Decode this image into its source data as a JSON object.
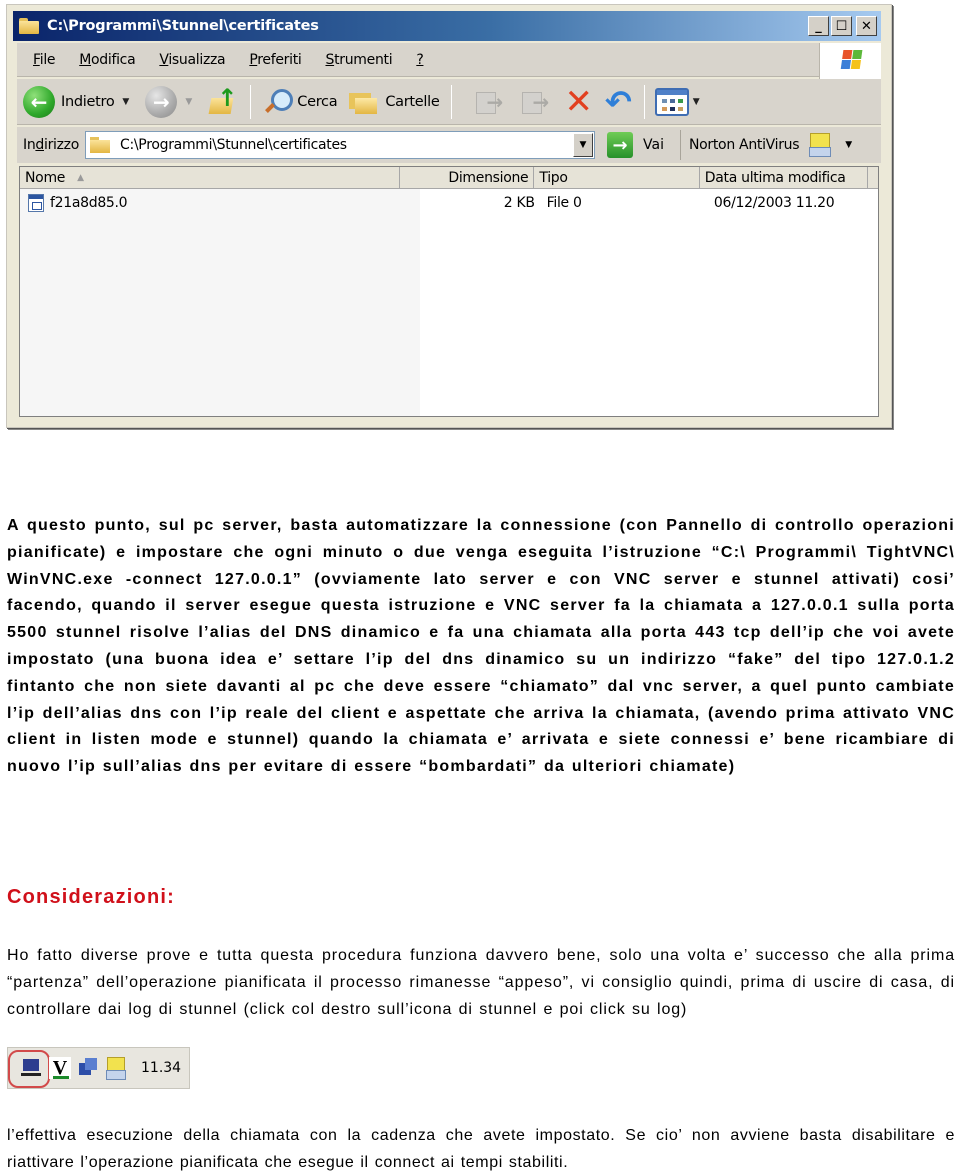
{
  "explorer": {
    "title": "C:\\Programmi\\Stunnel\\certificates",
    "window_buttons": {
      "minimize": "_",
      "maximize": "☐",
      "close": "✕"
    },
    "menu": [
      {
        "label": "File",
        "accel": "F",
        "rest": "ile"
      },
      {
        "label": "Modifica",
        "accel": "M",
        "rest": "odifica"
      },
      {
        "label": "Visualizza",
        "accel": "V",
        "rest": "isualizza"
      },
      {
        "label": "Preferiti",
        "accel": "P",
        "rest": "referiti"
      },
      {
        "label": "Strumenti",
        "accel": "S",
        "rest": "trumenti"
      },
      {
        "label": "?",
        "accel": "?",
        "rest": ""
      }
    ],
    "toolbar": {
      "back_label": "Indietro",
      "search_label": "Cerca",
      "folders_label": "Cartelle"
    },
    "address": {
      "label_pre": "In",
      "label_accel": "d",
      "label_post": "irizzo",
      "value": "C:\\Programmi\\Stunnel\\certificates",
      "go_label": "Vai",
      "norton_label": "Norton AntiVirus"
    },
    "columns": [
      "Nome",
      "Dimensione",
      "Tipo",
      "Data ultima modifica"
    ],
    "files": [
      {
        "name": "f21a8d85.0",
        "size": "2 KB",
        "type": "File 0",
        "modified": "06/12/2003 11.20"
      }
    ],
    "colors": {
      "title_start": "#0a246a",
      "title_end": "#a6caf0",
      "chrome": "#d8d4cc"
    }
  },
  "document": {
    "paragraph1": "A questo punto, sul pc server, basta automatizzare la connessione (con Pannello di controllo operazioni pianificate) e impostare che ogni minuto o due venga eseguita l’istruzione “C:\\ Programmi\\ TightVNC\\ WinVNC.exe -connect 127.0.0.1” (ovviamente lato server e con VNC server e stunnel attivati) cosi’ facendo, quando il server esegue questa istruzione e VNC server fa la chiamata a 127.0.0.1 sulla porta 5500 stunnel risolve l’alias del DNS dinamico e fa una chiamata alla porta 443 tcp dell’ip che voi avete impostato (una buona idea e’ settare l’ip del dns dinamico su un indirizzo “fake” del tipo 127.0.1.2 fintanto che non siete davanti al pc che deve essere “chiamato” dal vnc server, a quel punto cambiate l’ip dell’alias dns con l’ip reale del client e aspettate che arriva la chiamata, (avendo prima attivato VNC client in listen mode e stunnel) quando la chiamata e’ arrivata e siete connessi e’ bene ricambiare di nuovo l’ip sull’alias dns per evitare di essere “bombardati” da ulteriori chiamate)",
    "heading": "Considerazioni:",
    "heading_color": "#d0101a",
    "paragraph2": "Ho fatto diverse prove e tutta questa procedura funziona davvero bene, solo una volta e’ successo che alla prima “partenza” dell’operazione pianificata il processo rimanesse “appeso”, vi consiglio quindi, prima di uscire di casa, di controllare dai log di stunnel (click col destro sull’icona di stunnel e poi click su log)",
    "tray": {
      "icons": [
        "stunnel-icon",
        "vnc-icon",
        "network-icon",
        "antivirus-icon"
      ],
      "clock": "11.34",
      "highlighted": "stunnel-icon"
    },
    "paragraph3": "l’effettiva esecuzione della chiamata con la cadenza che avete impostato. Se cio’ non avviene basta disabilitare e riattivare l’operazione pianificata che esegue il connect ai tempi stabiliti."
  }
}
